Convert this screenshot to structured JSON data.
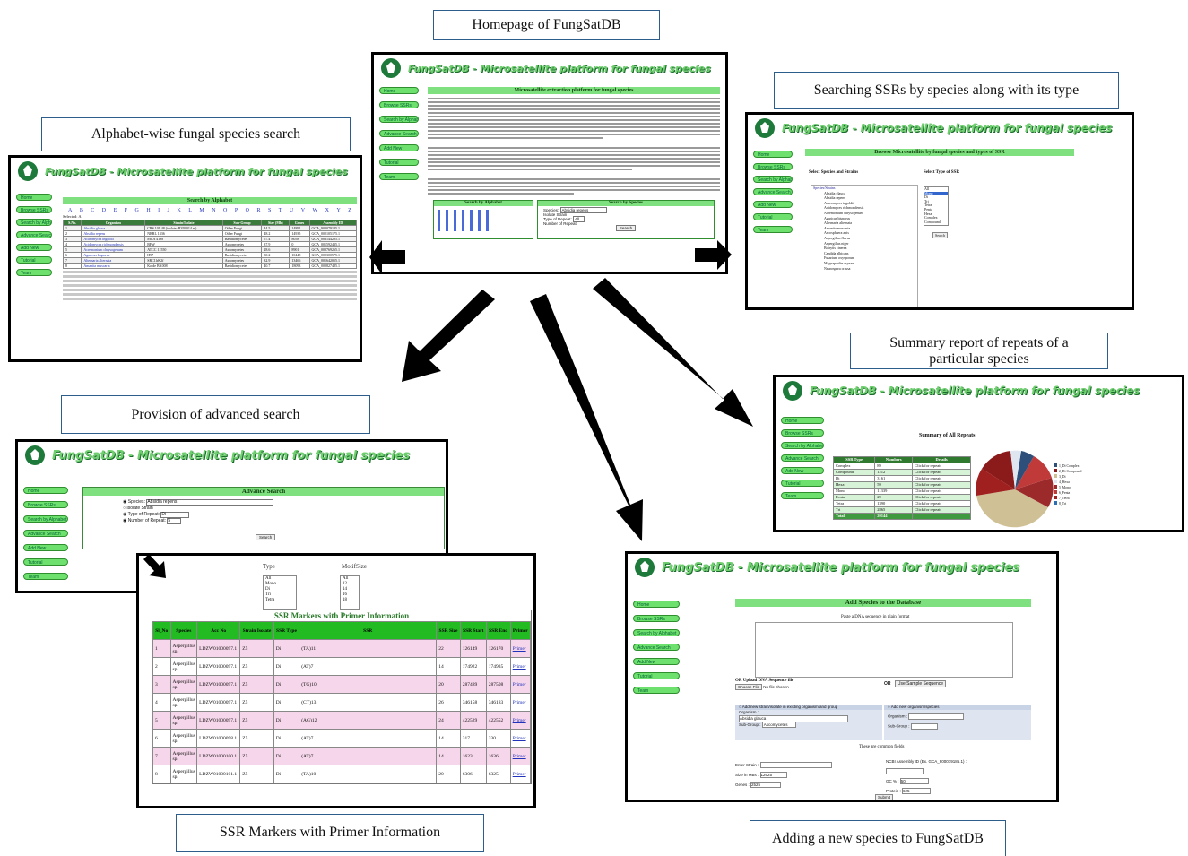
{
  "captions": {
    "homepage": "Homepage of FungSatDB",
    "alphabet": "Alphabet-wise fungal species search",
    "searching": "Searching SSRs by species along with its type",
    "summary": "Summary report of repeats of a particular species",
    "advanced": "Provision of advanced search",
    "markers": "SSR Markers with Primer Information",
    "adding": "Adding a new species to FungSatDB"
  },
  "site_title": "FungSatDB - Microsatellite platform for fungal species",
  "nav_items": [
    "Home",
    "Browse SSRs",
    "Search by Alphabet",
    "Advance Search",
    "Add New",
    "Tutorial",
    "Team"
  ],
  "home": {
    "heading": "Microsatellite extraction platform for fungal species",
    "search_alpha": "Search by Alphabet",
    "search_species": "Search by Species",
    "species_label": "Species",
    "isolate_label": "Isolate Strain",
    "type_label": "Type of Repeat",
    "number_label": "Number of Repeat",
    "species_value": "Absidia repens",
    "type_value": "All",
    "search_btn": "Search"
  },
  "alphabet_page": {
    "heading": "Search by Alphabet",
    "letters": [
      "A",
      "B",
      "C",
      "D",
      "E",
      "F",
      "G",
      "H",
      "I",
      "J",
      "K",
      "L",
      "M",
      "N",
      "O",
      "P",
      "Q",
      "R",
      "S",
      "T",
      "U",
      "V",
      "W",
      "X",
      "Y",
      "Z"
    ],
    "selected": "Selected: A",
    "columns": [
      "S.No.",
      "Organism",
      "Strain/Isolate",
      "Sub-Group",
      "Size (Mb)",
      "GC Percentage",
      "Genes",
      "Proteins",
      "Assembly ID"
    ],
    "rows": [
      [
        "1",
        "Absidia glauca",
        "CBS 101.48 (isolate: BVB 014 m)",
        "Other Fungi",
        "44.5",
        "14891",
        "GCA_900079185.1"
      ],
      [
        "2",
        "Absidia repens",
        "NRRL 1336",
        "Other Fungi",
        "48.2",
        "14935",
        "GCA_002105175.1"
      ],
      [
        "3",
        "Acaromyces ingoldii",
        "MCA 4198",
        "Basidiomycetes",
        "57.4",
        "8058",
        "GCA_003144295.1"
      ],
      [
        "4",
        "Acidomyces richmondensis",
        "BFW",
        "Ascomycetes",
        "37.9",
        "0",
        "GCA_001592435.1"
      ],
      [
        "5",
        "Acremonium chrysogenum",
        "ATCC 11550",
        "Ascomycetes",
        "28.6",
        "8901",
        "GCA_000769265.1"
      ],
      [
        "6",
        "Agaricus bisporus",
        "H97",
        "Basidiomycetes",
        "30.2",
        "10448",
        "GCA_000300575.1"
      ],
      [
        "7",
        "Alternaria alternata",
        "SRC1lrK2f",
        "Ascomycetes",
        "32.9",
        "13466",
        "GCA_001642055.1"
      ],
      [
        "8",
        "Amanita muscaria",
        "Koide BX008",
        "Basidiomycetes",
        "40.7",
        "18093",
        "GCA_000827485.1"
      ]
    ]
  },
  "browse_page": {
    "heading": "Browse Microsatellite by fungal species and types of SSR",
    "select_species": "Select Species and Strains",
    "select_type": "Select Type of SSR",
    "tree_root": "Species/Strains",
    "species_list": [
      "Absidia glauca",
      "Absidia repens",
      "Acaromyces ingoldii",
      "Acidomyces richmondensis",
      "Acremonium chrysogenum",
      "Agaricus bisporus",
      "Alternaria alternata",
      "Amanita muscaria",
      "Ascosphaera apis",
      "Aspergillus flavus",
      "Aspergillus niger",
      "Botrytis cinerea",
      "Candida albicans",
      "Fusarium oxysporum",
      "Magnaporthe oryzae",
      "Neurospora crassa"
    ],
    "types": [
      "All",
      "Mono",
      "Di",
      "Tri",
      "Tetra",
      "Penta",
      "Hexa",
      "Complex",
      "Compound"
    ],
    "search_btn": "Search"
  },
  "summary_page": {
    "heading": "Summary of All Repeats",
    "columns": [
      "SSR Type",
      "Numbers",
      "Details"
    ],
    "rows": [
      [
        "Complex",
        "89",
        "Click for repeats"
      ],
      [
        "Compound",
        "1212",
        "Click for repeats"
      ],
      [
        "Di",
        "3161",
        "Click for repeats"
      ],
      [
        "Hexa",
        "59",
        "Click for repeats"
      ],
      [
        "Mono",
        "11339",
        "Click for repeats"
      ],
      [
        "Penta",
        "29",
        "Click for repeats"
      ],
      [
        "Tetra",
        "1390",
        "Click for repeats"
      ],
      [
        "Tri",
        "2865",
        "Click for repeats"
      ]
    ],
    "total_label": "Total",
    "total_value": "20144",
    "legend": [
      "1_Di Complex",
      "2_Di Compound",
      "3_Di",
      "4_Hexa",
      "5_Mono",
      "6_Penta",
      "7_Tetra",
      "8_Tri"
    ]
  },
  "advanced_page": {
    "heading": "Advance Search",
    "species_label": "Species",
    "species_value": "Absidia repens",
    "isolate_label": "Isolate Strain",
    "type_label": "Type of Repeat",
    "type_value": "Di",
    "number_label": "Number of Repeat",
    "number_value": "5",
    "search_btn": "Search"
  },
  "markers_page": {
    "type_label": "Type",
    "motif_label": "MotifSize",
    "type_options": [
      "All",
      "Mono",
      "Di",
      "Tri",
      "Tetra"
    ],
    "motif_options": [
      "All",
      "12",
      "14",
      "16",
      "18"
    ],
    "heading": "SSR Markers with Primer Information",
    "columns": [
      "Sl_No",
      "Species",
      "Acc No",
      "Strain Isolate",
      "SSR Type",
      "SSR",
      "SSR Size",
      "SSR Start",
      "SSR End",
      "Primer"
    ],
    "rows": [
      [
        "1",
        "Aspergillus sp.",
        "LDZW01000097.1",
        "Z5",
        "Di",
        "(TA)11",
        "22",
        "126149",
        "126170",
        "Primer"
      ],
      [
        "2",
        "Aspergillus sp.",
        "LDZW01000097.1",
        "Z5",
        "Di",
        "(AT)7",
        "14",
        "174922",
        "174935",
        "Primer"
      ],
      [
        "3",
        "Aspergillus sp.",
        "LDZW01000097.1",
        "Z5",
        "Di",
        "(TG)10",
        "20",
        "287489",
        "287508",
        "Primer"
      ],
      [
        "4",
        "Aspergillus sp.",
        "LDZW01000097.1",
        "Z5",
        "Di",
        "(CT)13",
        "26",
        "346158",
        "346183",
        "Primer"
      ],
      [
        "5",
        "Aspergillus sp.",
        "LDZW01000097.1",
        "Z5",
        "Di",
        "(AG)12",
        "24",
        "422529",
        "422552",
        "Primer"
      ],
      [
        "6",
        "Aspergillus sp.",
        "LDZW01000098.1",
        "Z5",
        "Di",
        "(AT)7",
        "14",
        "317",
        "330",
        "Primer"
      ],
      [
        "7",
        "Aspergillus sp.",
        "LDZW01000100.1",
        "Z5",
        "Di",
        "(AT)7",
        "14",
        "1623",
        "1636",
        "Primer"
      ],
      [
        "8",
        "Aspergillus sp.",
        "LDZW01000101.1",
        "Z5",
        "Di",
        "(TA)10",
        "20",
        "6306",
        "6325",
        "Primer"
      ]
    ]
  },
  "add_page": {
    "heading": "Add Species to the Database",
    "paste_label": "Paste a DNA sequence in plain format",
    "or_upload": "OR Upload DNA Sequence file",
    "choose_file": "Choose File",
    "no_file": "No file chosen",
    "or_label": "OR",
    "use_sample": "Use Sample Sequence",
    "existing_label": "Add new strain/isolate in existing organism and group",
    "new_label": "Add new organism/species",
    "organism_label": "Organism :",
    "organism_value": "Absidia glauca",
    "subgroup_label": "Sub-Group :",
    "subgroup_value": "Ascomycetes",
    "organism_label2": "Organism :",
    "subgroup_label2": "Sub-Group :",
    "common_fields": "These are common fields",
    "strain_label": "Enter Strain :",
    "ncbi_label": "NCBI Assembly ID (Ex. GCA_900079185.1) :",
    "size_label": "Size in MBs :",
    "size_value": "12625",
    "gc_label": "GC % :",
    "gc_value": "50",
    "genes_label": "Genes :",
    "genes_value": "2525",
    "protein_label": "Protein :",
    "protein_value": "625",
    "submit": "Submit"
  }
}
